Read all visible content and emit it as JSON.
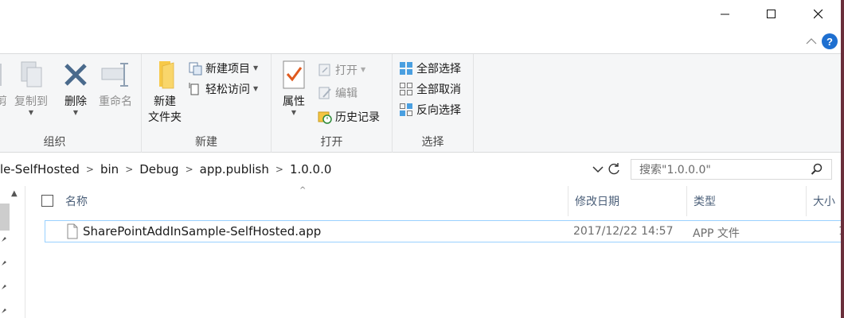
{
  "ribbon": {
    "clipboard": {
      "cut_partial": "剪",
      "copy_to": "复制到",
      "delete": "删除",
      "rename": "重命名",
      "group_label": "组织"
    },
    "new": {
      "new_folder_line1": "新建",
      "new_folder_line2": "文件夹",
      "new_item": "新建项目",
      "easy_access": "轻松访问",
      "group_label": "新建"
    },
    "open": {
      "properties": "属性",
      "open": "打开",
      "edit": "编辑",
      "history": "历史记录",
      "group_label": "打开"
    },
    "select": {
      "select_all": "全部选择",
      "select_none": "全部取消",
      "invert": "反向选择",
      "group_label": "选择"
    }
  },
  "address": {
    "crumbs": [
      "le-SelfHosted",
      "bin",
      "Debug",
      "app.publish",
      "1.0.0.0"
    ],
    "search_placeholder": "搜索\"1.0.0.0\""
  },
  "columns": {
    "name": "名称",
    "modified": "修改日期",
    "type": "类型",
    "size": "大小"
  },
  "files": [
    {
      "name": "SharePointAddInSample-SelfHosted.app",
      "modified": "2017/12/22 14:57",
      "type": "APP 文件",
      "size": "1"
    }
  ],
  "colors": {
    "accent": "#1e6fd0",
    "selection_border": "#99d1ff",
    "ribbon_bg": "#f5f6f7"
  },
  "icons": [
    "minimize-icon",
    "maximize-icon",
    "close-icon",
    "help-icon",
    "copy-icon",
    "delete-icon",
    "rename-icon",
    "folder-icon",
    "new-item-icon",
    "easy-access-icon",
    "properties-icon",
    "open-icon",
    "edit-icon",
    "history-icon",
    "select-all-icon",
    "select-none-icon",
    "invert-selection-icon",
    "refresh-icon",
    "search-icon",
    "file-icon",
    "pin-icon"
  ]
}
